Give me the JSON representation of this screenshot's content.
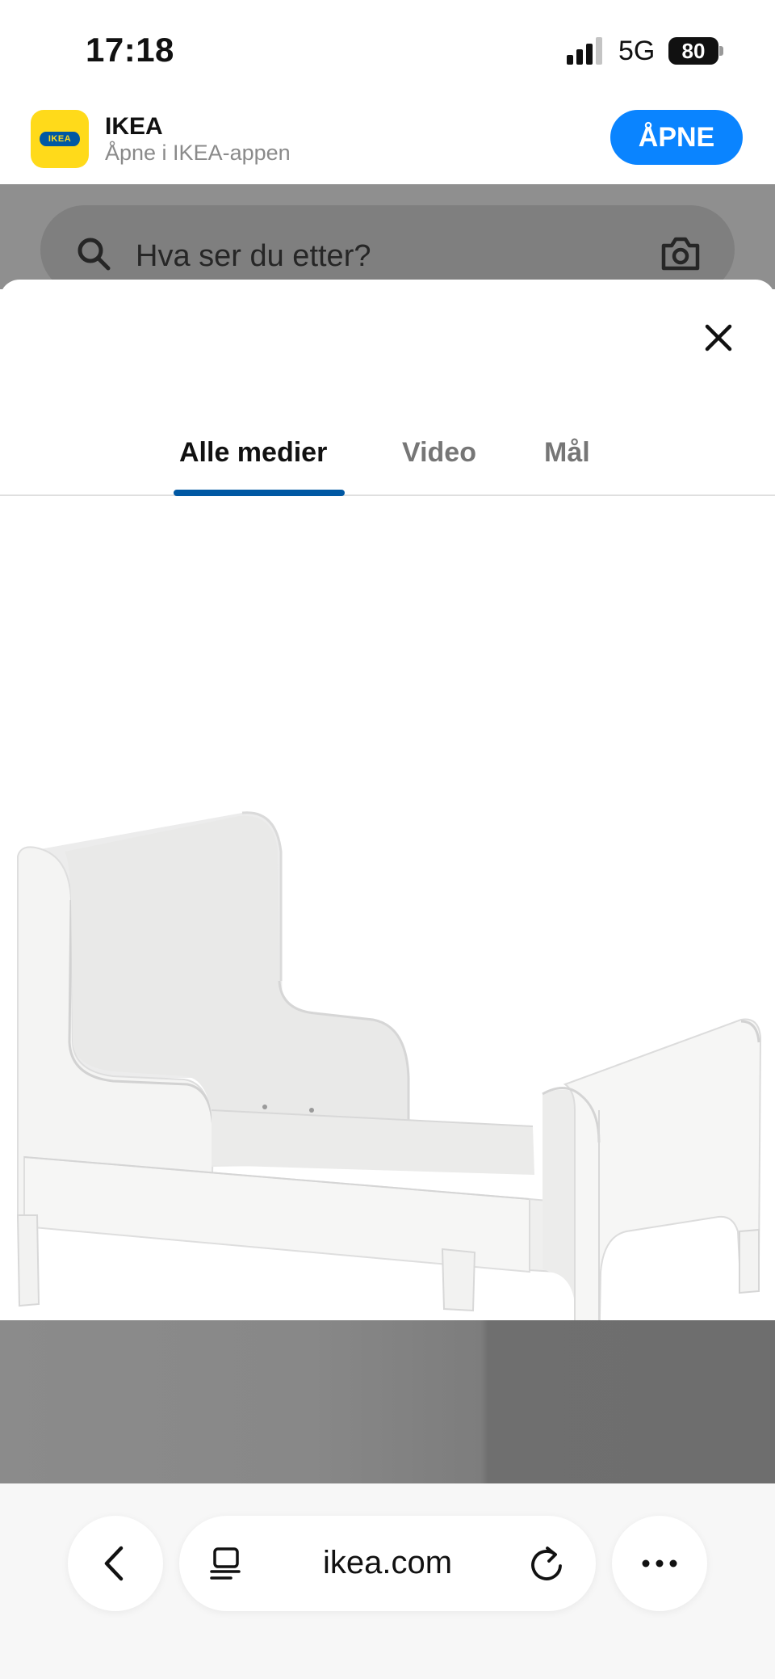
{
  "status_bar": {
    "time": "17:18",
    "network": "5G",
    "battery": "80"
  },
  "app_banner": {
    "icon_text": "IKEA",
    "name": "IKEA",
    "subtitle": "Åpne i IKEA-appen",
    "open_label": "ÅPNE"
  },
  "search": {
    "placeholder": "Hva ser du etter?"
  },
  "tabs": [
    {
      "label": "Alle medier",
      "active": true
    },
    {
      "label": "Video",
      "active": false
    },
    {
      "label": "Mål",
      "active": false
    }
  ],
  "browser": {
    "url": "ikea.com"
  },
  "colors": {
    "accent_blue": "#0058A3",
    "ikea_yellow": "#FFDA1A",
    "open_button": "#0A84FF"
  }
}
